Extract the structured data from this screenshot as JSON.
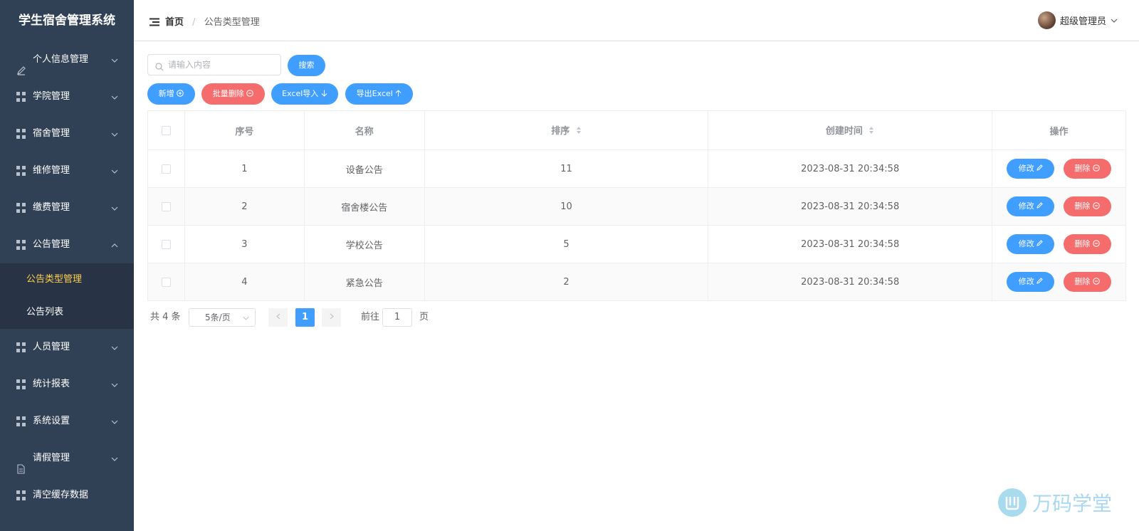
{
  "sidebar": {
    "title": "学生宿舍管理系统",
    "items": [
      {
        "label": "个人信息管理",
        "icon": "edit-icon"
      },
      {
        "label": "学院管理",
        "icon": "grid-icon"
      },
      {
        "label": "宿舍管理",
        "icon": "grid-icon"
      },
      {
        "label": "维修管理",
        "icon": "grid-icon"
      },
      {
        "label": "缴费管理",
        "icon": "grid-icon"
      },
      {
        "label": "公告管理",
        "icon": "grid-icon",
        "expanded": true
      },
      {
        "label": "人员管理",
        "icon": "grid-icon"
      },
      {
        "label": "统计报表",
        "icon": "grid-icon"
      },
      {
        "label": "系统设置",
        "icon": "grid-icon"
      },
      {
        "label": "请假管理",
        "icon": "document-icon"
      },
      {
        "label": "清空缓存数据",
        "icon": "grid-icon"
      }
    ],
    "sub_items": [
      {
        "label": "公告类型管理",
        "active": true
      },
      {
        "label": "公告列表",
        "active": false
      }
    ]
  },
  "header": {
    "home": "首页",
    "separator": "/",
    "current": "公告类型管理",
    "user": "超级管理员"
  },
  "toolbar": {
    "search_placeholder": "请输入内容",
    "search_label": "搜索",
    "add_label": "新增",
    "batch_delete_label": "批量删除",
    "import_label": "Excel导入",
    "export_label": "导出Excel"
  },
  "table": {
    "headers": {
      "index": "序号",
      "name": "名称",
      "sort": "排序",
      "created": "创建时间",
      "actions": "操作"
    },
    "edit_label": "修改",
    "delete_label": "删除",
    "rows": [
      {
        "index": "1",
        "name": "设备公告",
        "sort": "11",
        "created": "2023-08-31 20:34:58"
      },
      {
        "index": "2",
        "name": "宿舍楼公告",
        "sort": "10",
        "created": "2023-08-31 20:34:58"
      },
      {
        "index": "3",
        "name": "学校公告",
        "sort": "5",
        "created": "2023-08-31 20:34:58"
      },
      {
        "index": "4",
        "name": "紧急公告",
        "sort": "2",
        "created": "2023-08-31 20:34:58"
      }
    ]
  },
  "pagination": {
    "total": "共 4 条",
    "page_size": "5条/页",
    "current_page": "1",
    "goto_label": "前往",
    "goto_value": "1",
    "page_unit": "页"
  },
  "watermark": {
    "text": "万码学堂"
  },
  "colors": {
    "sidebar": "#304156",
    "primary": "#409eff",
    "danger": "#f56c6c",
    "active_menu": "#ffd04b"
  }
}
